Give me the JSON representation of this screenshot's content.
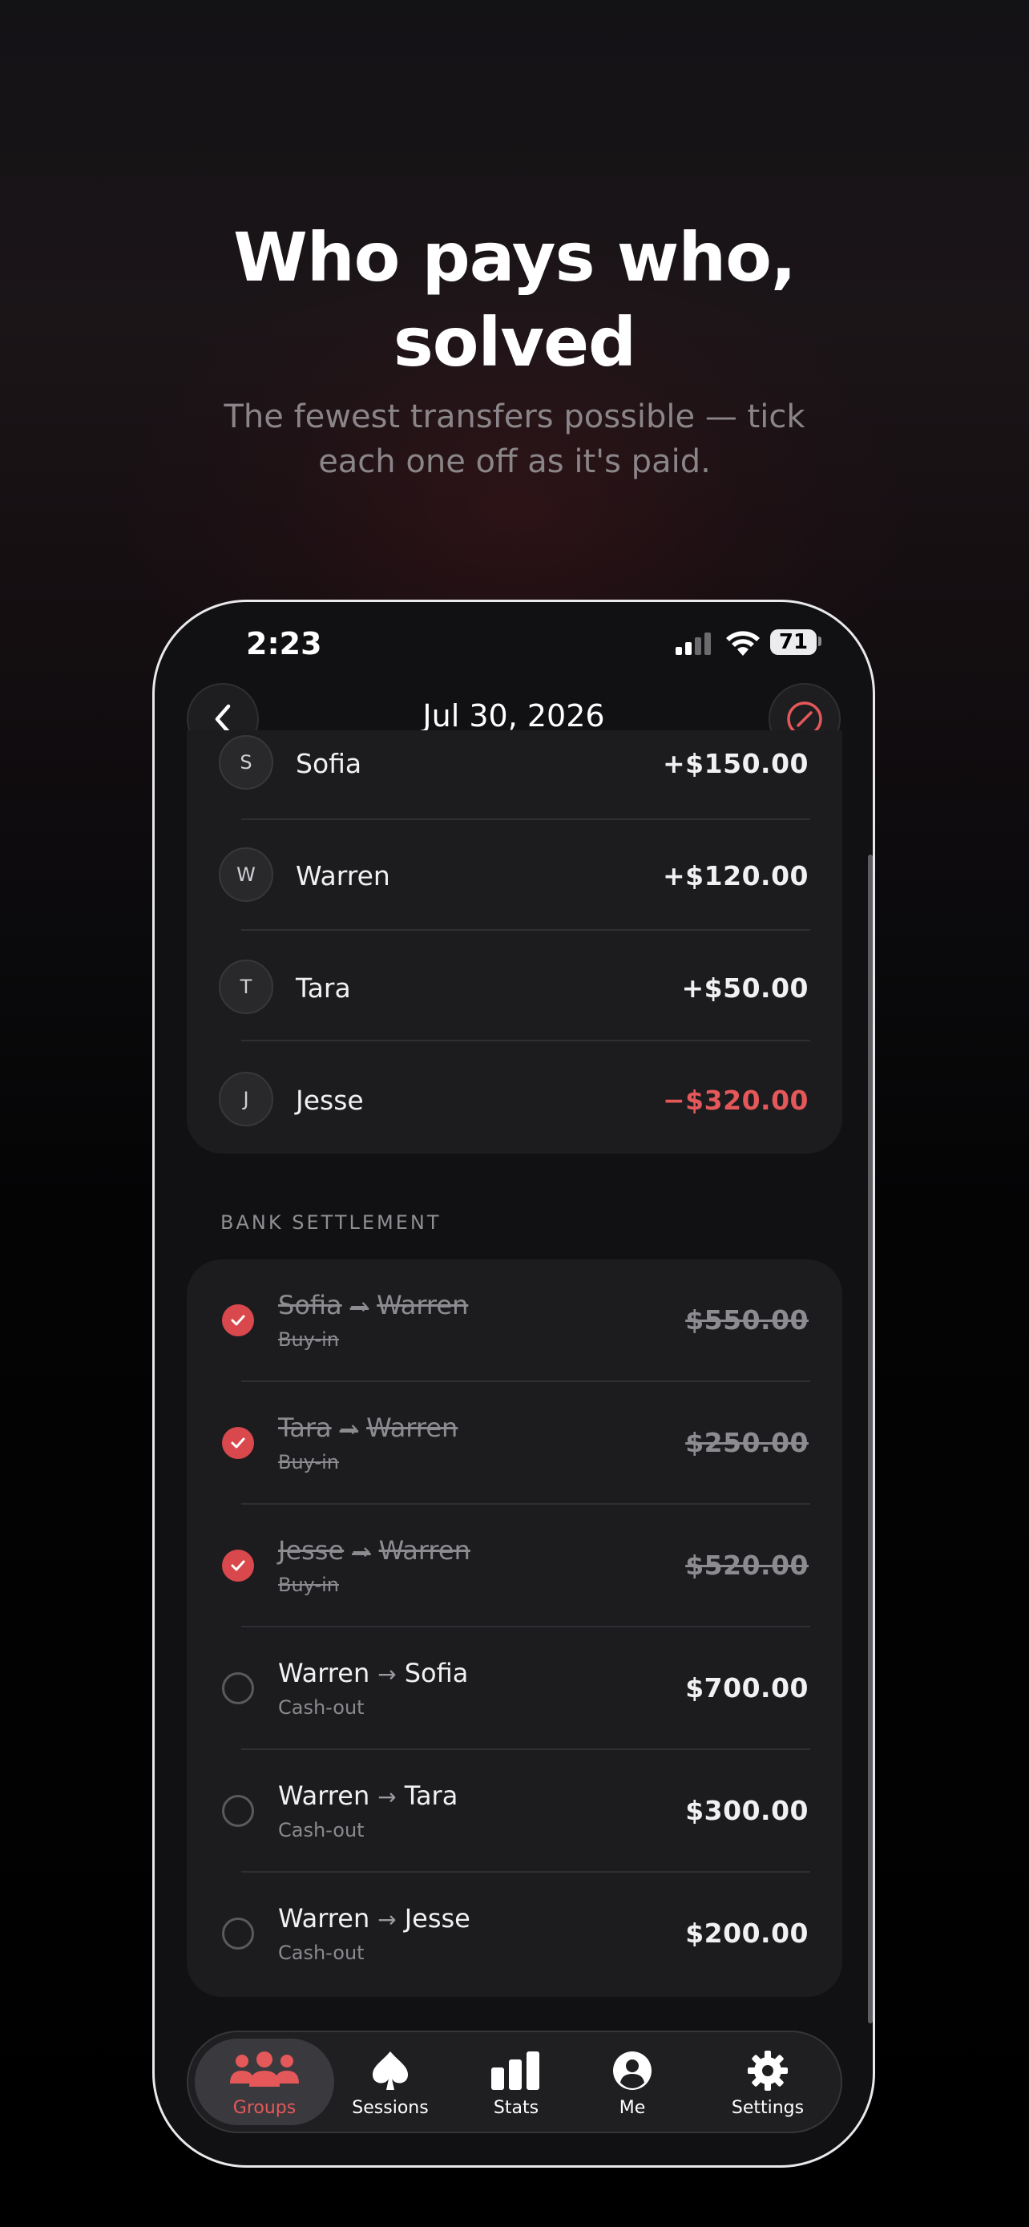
{
  "hero": {
    "title_line1": "Who pays who,",
    "title_line2": "solved",
    "subtitle_line1": "The fewest transfers possible — tick",
    "subtitle_line2": "each one off as it's paid."
  },
  "status_bar": {
    "time": "2:23",
    "battery": "71"
  },
  "nav": {
    "title": "Jul 30, 2026"
  },
  "balances": [
    {
      "initial": "S",
      "name": "Sofia",
      "amount": "+$150.00",
      "negative": false
    },
    {
      "initial": "W",
      "name": "Warren",
      "amount": "+$120.00",
      "negative": false
    },
    {
      "initial": "T",
      "name": "Tara",
      "amount": "+$50.00",
      "negative": false
    },
    {
      "initial": "J",
      "name": "Jesse",
      "amount": "−$320.00",
      "negative": true
    }
  ],
  "settlement": {
    "section_label": "BANK SETTLEMENT",
    "arrow": "→",
    "rows": [
      {
        "from": "Sofia",
        "to": "Warren",
        "type": "Buy-in",
        "amount": "$550.00",
        "paid": true
      },
      {
        "from": "Tara",
        "to": "Warren",
        "type": "Buy-in",
        "amount": "$250.00",
        "paid": true
      },
      {
        "from": "Jesse",
        "to": "Warren",
        "type": "Buy-in",
        "amount": "$520.00",
        "paid": true
      },
      {
        "from": "Warren",
        "to": "Sofia",
        "type": "Cash-out",
        "amount": "$700.00",
        "paid": false
      },
      {
        "from": "Warren",
        "to": "Tara",
        "type": "Cash-out",
        "amount": "$300.00",
        "paid": false
      },
      {
        "from": "Warren",
        "to": "Jesse",
        "type": "Cash-out",
        "amount": "$200.00",
        "paid": false
      }
    ]
  },
  "tabbar": {
    "tabs": [
      {
        "label": "Groups",
        "icon": "people-icon",
        "active": true
      },
      {
        "label": "Sessions",
        "icon": "spade-icon",
        "active": false
      },
      {
        "label": "Stats",
        "icon": "bar-chart-icon",
        "active": false
      },
      {
        "label": "Me",
        "icon": "person-circle-icon",
        "active": false
      },
      {
        "label": "Settings",
        "icon": "gear-icon",
        "active": false
      }
    ]
  },
  "colors": {
    "accent": "#e5585a",
    "check": "#d9484c",
    "card": "#1c1c1f",
    "background": "#000000"
  }
}
